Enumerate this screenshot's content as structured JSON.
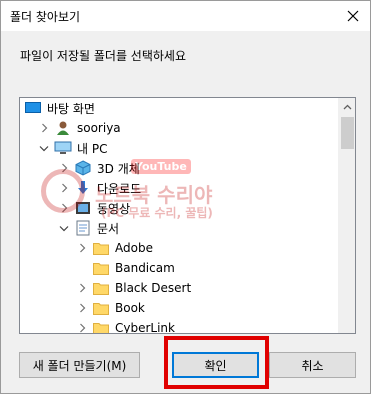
{
  "dialog": {
    "title": "폴더 찾아보기",
    "instruction": "파일이 저장될 폴더를 선택하세요"
  },
  "tree": {
    "items": [
      {
        "label": "바탕 화면",
        "icon": "desktop-icon",
        "level": 0,
        "expander": "none"
      },
      {
        "label": "sooriya",
        "icon": "user-icon",
        "level": 1,
        "expander": "collapsed"
      },
      {
        "label": "내 PC",
        "icon": "computer-icon",
        "level": 1,
        "expander": "expanded"
      },
      {
        "label": "3D 개체",
        "icon": "3d-objects-icon",
        "level": 2,
        "expander": "collapsed"
      },
      {
        "label": "다운로드",
        "icon": "download-icon",
        "level": 2,
        "expander": "collapsed"
      },
      {
        "label": "동영상",
        "icon": "video-icon",
        "level": 2,
        "expander": "collapsed"
      },
      {
        "label": "문서",
        "icon": "document-icon",
        "level": 2,
        "expander": "expanded"
      },
      {
        "label": "Adobe",
        "icon": "folder-icon",
        "level": 3,
        "expander": "collapsed"
      },
      {
        "label": "Bandicam",
        "icon": "folder-icon",
        "level": 3,
        "expander": "none"
      },
      {
        "label": "Black Desert",
        "icon": "folder-icon",
        "level": 3,
        "expander": "collapsed"
      },
      {
        "label": "Book",
        "icon": "folder-icon",
        "level": 3,
        "expander": "collapsed"
      },
      {
        "label": "CyberLink",
        "icon": "folder-icon",
        "level": 3,
        "expander": "collapsed"
      }
    ]
  },
  "watermark": {
    "badge": "YouTube",
    "title": "노트북 수리야",
    "subtitle": "(PC 무료 수리, 꿀팁)"
  },
  "buttons": {
    "new_folder": "새 폴더 만들기(M)",
    "ok": "확인",
    "cancel": "취소"
  },
  "colors": {
    "highlight_box": "#e00000",
    "folder": "#ffd868",
    "default_button_border": "#0078d7"
  }
}
